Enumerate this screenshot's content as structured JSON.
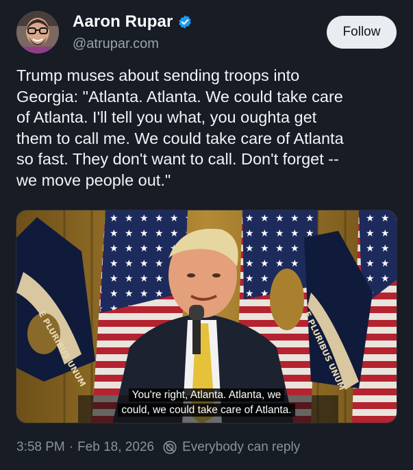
{
  "author": {
    "display_name": "Aaron Rupar",
    "handle": "@atrupar.com",
    "verified_icon": "verified-check-icon",
    "verified_color": "#1d9bf0"
  },
  "follow_label": "Follow",
  "tweet": {
    "text": "Trump muses about sending troops into\nGeorgia: \"Atlanta. Atlanta. We could take care\nof Atlanta. I'll tell you what, you oughta get\nthem to call me. We could take care of Atlanta\nso fast. They don't want to call. Don't forget --\nwe move people out.\""
  },
  "media": {
    "caption_line1": "You're right, Atlanta. Atlanta, we",
    "caption_line2": "could, we could take care of Atlanta.",
    "seal_text": "E PLURIBUS UNUM"
  },
  "meta": {
    "time": "3:58 PM",
    "separator": "·",
    "date": "Feb 18, 2026",
    "reply_icon": "reply-settings-icon",
    "reply_setting": "Everybody can reply"
  },
  "colors": {
    "background": "#171c25",
    "follow_bg": "#e9edf1",
    "muted_text": "#8a939c"
  }
}
